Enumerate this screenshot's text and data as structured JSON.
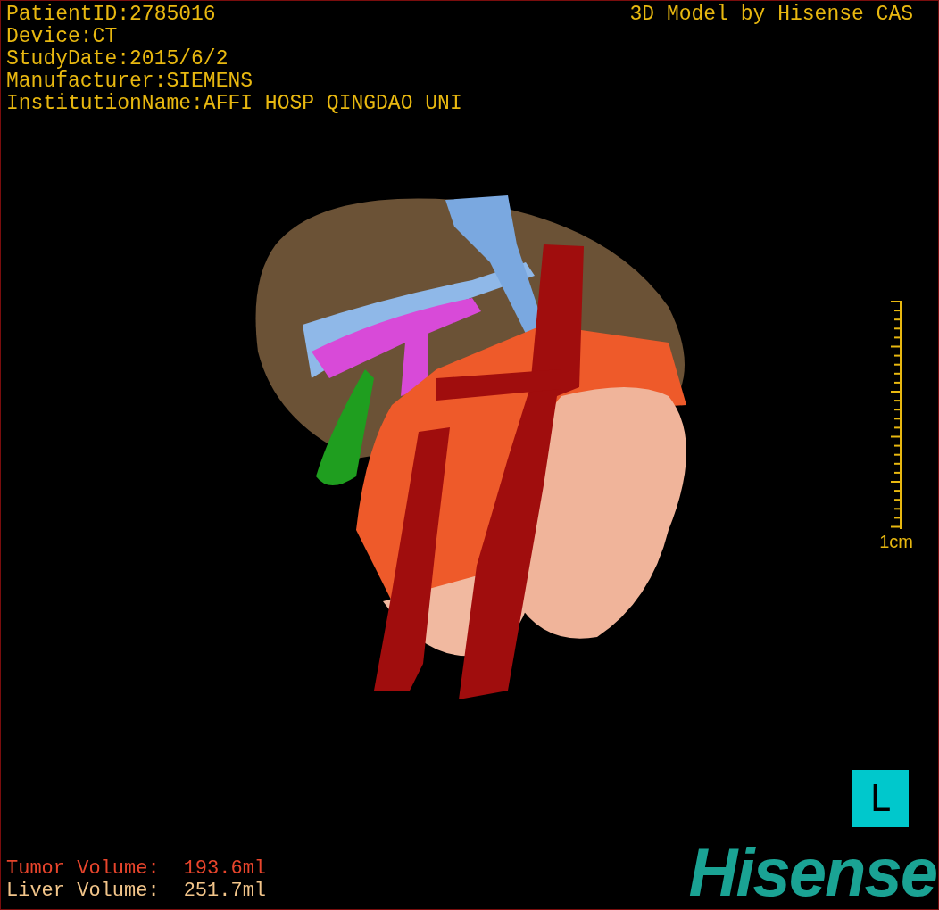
{
  "patient_info": [
    "PatientID:2785016",
    "Device:CT",
    "StudyDate:2015/6/2",
    "Manufacturer:SIEMENS",
    "InstitutionName:AFFI HOSP QINGDAO UNI"
  ],
  "title": "3D Model by Hisense CAS",
  "scale": {
    "label": "1cm"
  },
  "volumes": [
    {
      "label": "Tumor Volume:",
      "value": "193.6ml",
      "color": "#e8452c"
    },
    {
      "label": "Liver Volume:",
      "value": "251.7ml",
      "color": "#f2c58a"
    }
  ],
  "orientation_marker": "L",
  "logo": "Hisense"
}
